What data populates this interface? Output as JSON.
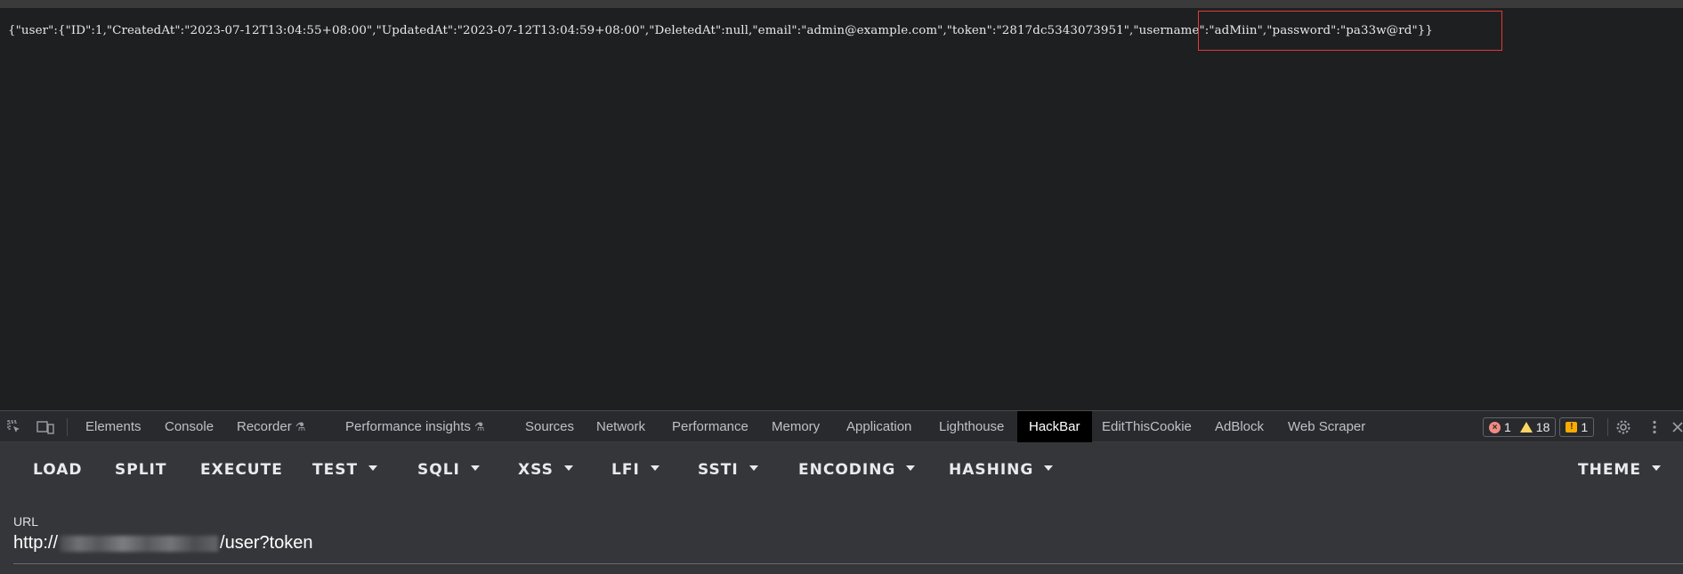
{
  "page": {
    "json_before": "{\"user\":{\"ID\":1,\"CreatedAt\":\"2023-07-12T13:04:55+08:00\",\"UpdatedAt\":\"2023-07-12T13:04:59+08:00\",\"DeletedAt\":null,\"email\":\"admin@example.com\",\"token\":\"2817dc5343073951\",",
    "json_highlighted": "\"username\":\"adMiin\",\"password\":\"pa33w@rd\"}}",
    "highlight_color": "#e53935"
  },
  "devtools": {
    "icons": [
      "inspect-element-icon",
      "device-toolbar-icon"
    ],
    "tabs": [
      {
        "label": "Elements"
      },
      {
        "label": "Console"
      },
      {
        "label": "Recorder",
        "experimental": true
      },
      {
        "label": "Performance insights",
        "experimental": true
      },
      {
        "label": "Sources"
      },
      {
        "label": "Network"
      },
      {
        "label": "Performance"
      },
      {
        "label": "Memory"
      },
      {
        "label": "Application"
      },
      {
        "label": "Lighthouse"
      },
      {
        "label": "HackBar",
        "active": true
      },
      {
        "label": "EditThisCookie"
      },
      {
        "label": "AdBlock"
      },
      {
        "label": "Web Scraper"
      }
    ],
    "errors": "1",
    "warnings": "18",
    "issues": "1",
    "right_icons": [
      "settings-icon",
      "more-options-icon",
      "close-icon"
    ]
  },
  "hackbar": {
    "buttons": [
      {
        "label": "LOAD"
      },
      {
        "label": "SPLIT"
      },
      {
        "label": "EXECUTE"
      },
      {
        "label": "TEST",
        "dropdown": true
      },
      {
        "label": "SQLI",
        "dropdown": true
      },
      {
        "label": "XSS",
        "dropdown": true
      },
      {
        "label": "LFI",
        "dropdown": true
      },
      {
        "label": "SSTI",
        "dropdown": true
      },
      {
        "label": "ENCODING",
        "dropdown": true
      },
      {
        "label": "HASHING",
        "dropdown": true
      }
    ],
    "theme_label": "THEME",
    "url_label": "URL",
    "url_prefix": "http://",
    "url_suffix": "/user?token"
  }
}
